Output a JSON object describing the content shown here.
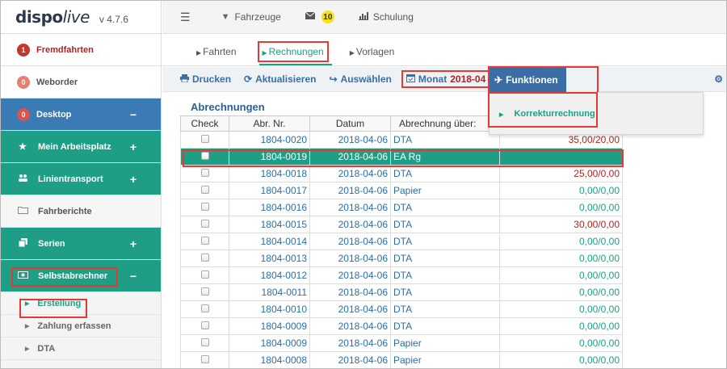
{
  "app": {
    "logo_main": "dispo",
    "logo_italic": "live",
    "version": "v 4.7.6"
  },
  "sidebar": {
    "items": [
      {
        "label": "Fremdfahrten",
        "badge": "1"
      },
      {
        "label": "Weborder",
        "badge": "0"
      },
      {
        "label": "Desktop",
        "badge": "0",
        "toggle": "−"
      },
      {
        "label": "Mein Arbeitsplatz",
        "toggle": "+"
      },
      {
        "label": "Linientransport",
        "toggle": "+"
      },
      {
        "label": "Fahrberichte"
      },
      {
        "label": "Serien",
        "toggle": "+"
      },
      {
        "label": "Selbstabrechner",
        "toggle": "−"
      }
    ],
    "subitems": [
      {
        "label": "Erstellung"
      },
      {
        "label": "Zahlung erfassen"
      },
      {
        "label": "DTA"
      }
    ]
  },
  "topbar": {
    "fahrzeuge": "Fahrzeuge",
    "messages_count": "10",
    "schulung": "Schulung"
  },
  "tabs": [
    {
      "label": "Fahrten"
    },
    {
      "label": "Rechnungen"
    },
    {
      "label": "Vorlagen"
    }
  ],
  "toolbar": {
    "drucken": "Drucken",
    "aktualisieren": "Aktualisieren",
    "auswaehlen": "Auswählen",
    "monat_label": "Monat",
    "monat_value": "2018-04",
    "funktionen": "Funktionen"
  },
  "dropdown": {
    "option": "Korrekturrechnung"
  },
  "table": {
    "title": "Abrechnungen",
    "headers": [
      "Check",
      "Abr. Nr.",
      "Datum",
      "Abrechnung über:",
      ""
    ],
    "rows": [
      {
        "nr": "1804-0020",
        "datum": "2018-04-06",
        "ueber": "DTA",
        "betrag": "35,00/20,00",
        "status": "red"
      },
      {
        "nr": "1804-0019",
        "datum": "2018-04-06",
        "ueber": "EA Rg",
        "betrag": "",
        "status": "selected"
      },
      {
        "nr": "1804-0018",
        "datum": "2018-04-06",
        "ueber": "DTA",
        "betrag": "25,00/0,00",
        "status": "red"
      },
      {
        "nr": "1804-0017",
        "datum": "2018-04-06",
        "ueber": "Papier",
        "betrag": "0,00/0,00",
        "status": "green"
      },
      {
        "nr": "1804-0016",
        "datum": "2018-04-06",
        "ueber": "DTA",
        "betrag": "0,00/0,00",
        "status": "green"
      },
      {
        "nr": "1804-0015",
        "datum": "2018-04-06",
        "ueber": "DTA",
        "betrag": "30,00/0,00",
        "status": "red"
      },
      {
        "nr": "1804-0014",
        "datum": "2018-04-06",
        "ueber": "DTA",
        "betrag": "0,00/0,00",
        "status": "green"
      },
      {
        "nr": "1804-0013",
        "datum": "2018-04-06",
        "ueber": "DTA",
        "betrag": "0,00/0,00",
        "status": "green"
      },
      {
        "nr": "1804-0012",
        "datum": "2018-04-06",
        "ueber": "DTA",
        "betrag": "0,00/0,00",
        "status": "green"
      },
      {
        "nr": "1804-0011",
        "datum": "2018-04-06",
        "ueber": "DTA",
        "betrag": "0,00/0,00",
        "status": "green"
      },
      {
        "nr": "1804-0010",
        "datum": "2018-04-06",
        "ueber": "DTA",
        "betrag": "0,00/0,00",
        "status": "green"
      },
      {
        "nr": "1804-0009",
        "datum": "2018-04-06",
        "ueber": "DTA",
        "betrag": "0,00/0,00",
        "status": "green"
      },
      {
        "nr": "1804-0009",
        "datum": "2018-04-06",
        "ueber": "Papier",
        "betrag": "0,00/0,00",
        "status": "green"
      },
      {
        "nr": "1804-0008",
        "datum": "2018-04-06",
        "ueber": "Papier",
        "betrag": "0,00/0,00",
        "status": "green"
      }
    ]
  }
}
